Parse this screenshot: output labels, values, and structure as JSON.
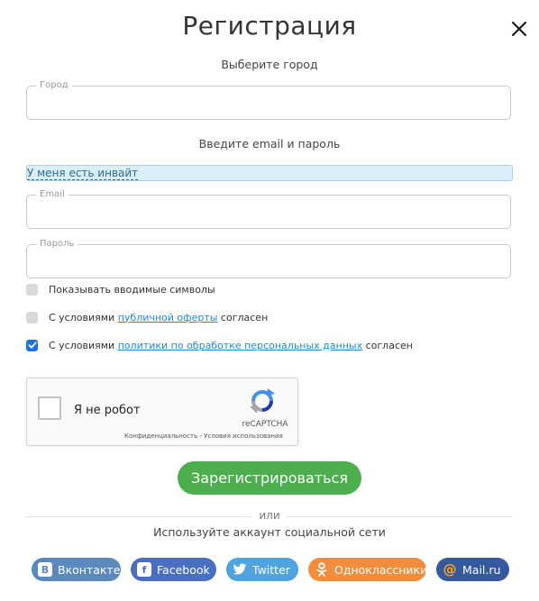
{
  "title": "Регистрация",
  "sections": {
    "city": "Выберите город",
    "email_password": "Введите email и пароль"
  },
  "fields": {
    "city": {
      "legend": "Город",
      "value": ""
    },
    "email": {
      "legend": "Email",
      "value": ""
    },
    "password": {
      "legend": "Пароль",
      "value": ""
    }
  },
  "invite_link": "У меня есть инвайт",
  "checkboxes": {
    "show_chars": {
      "label": "Показывать вводимые символы",
      "checked": false
    },
    "offer": {
      "prefix": "С условиями",
      "link": "публичной оферты",
      "suffix": "согласен",
      "checked": false
    },
    "privacy": {
      "prefix": "С условиями",
      "link": "политики по обработке персональных данных",
      "suffix": "согласен",
      "checked": true
    }
  },
  "captcha": {
    "label": "Я не робот",
    "brand": "reCAPTCHA",
    "links": "Конфиденциальность - Условия использования"
  },
  "register_button": "Зарегистрироваться",
  "or": "или",
  "social_label": "Используйте аккаунт социальной сети",
  "social": {
    "vk": {
      "label": "Вконтакте",
      "color": "#5b88bd"
    },
    "facebook": {
      "label": "Facebook",
      "color": "#4a6fbf"
    },
    "twitter": {
      "label": "Twitter",
      "color": "#4fa3e0"
    },
    "ok": {
      "label": "Одноклассники",
      "color": "#f28d3e"
    },
    "mailru": {
      "label": "Mail.ru",
      "color": "#35599c"
    }
  },
  "colors": {
    "accent_green": "#4cae4c",
    "link_blue": "#1a8cd8",
    "checkbox_on": "#1a73e8"
  }
}
